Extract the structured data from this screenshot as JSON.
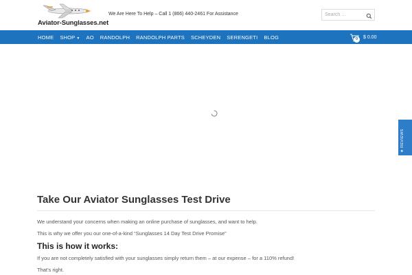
{
  "header": {
    "logo_text": "Aviator-Sunglasses.net",
    "tagline": "We Are Here To Help – Call 1 (866) 440-2461 For Assistance",
    "search_placeholder": "Search …"
  },
  "nav": {
    "items": [
      {
        "label": "HOME"
      },
      {
        "label": "SHOP",
        "has_dropdown": true
      },
      {
        "label": "AO"
      },
      {
        "label": "RANDOLPH"
      },
      {
        "label": "RANDOLPH PARTS"
      },
      {
        "label": "SCHEYDEN"
      },
      {
        "label": "SERENGETI"
      },
      {
        "label": "BLOG"
      }
    ],
    "cart": {
      "count": "0",
      "total": "$ 0.00"
    }
  },
  "reviews_tab": {
    "label": "★ REVIEWS"
  },
  "content": {
    "title": "Take Our Aviator Sunglasses Test Drive",
    "p1": "We understand your concerns when making an online purchase of sunglasses, and want to help.",
    "p2": "This is why we offer you our one-of-a-kind “Sunglasses 14 Day Test Drive Promise”",
    "subtitle": "This is how it works:",
    "p3": "If you are not completely satisfied with your sunglasses simply return them – at our expense – for a 110% refund!",
    "p4": "That’s right."
  },
  "colors": {
    "nav_bg": "#1e73be",
    "reviews_bg": "#2d7dc9"
  }
}
